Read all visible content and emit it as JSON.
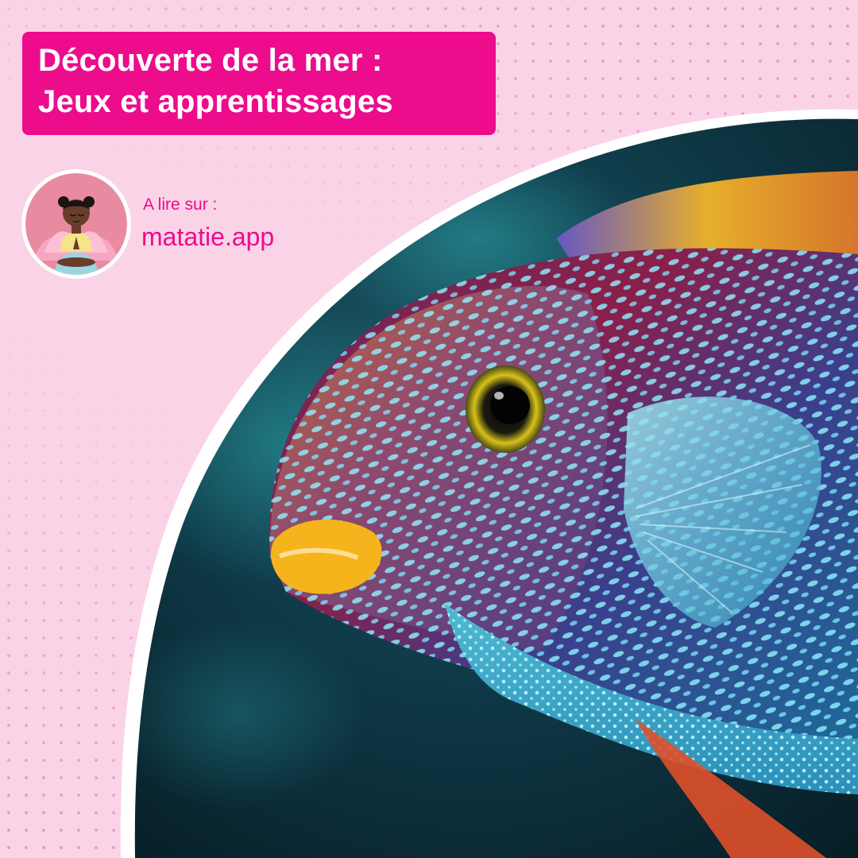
{
  "title": {
    "line1": "Découverte de la mer :",
    "line2": "Jeux et apprentissages"
  },
  "source": {
    "label": "A lire sur :",
    "link_text": "matatie.app"
  },
  "colors": {
    "background": "#fbd3e6",
    "accent": "#ec0c8c",
    "dots": "#f08cbc"
  },
  "image": {
    "subject": "fish-photo",
    "logo": "meditating-child-avatar"
  }
}
